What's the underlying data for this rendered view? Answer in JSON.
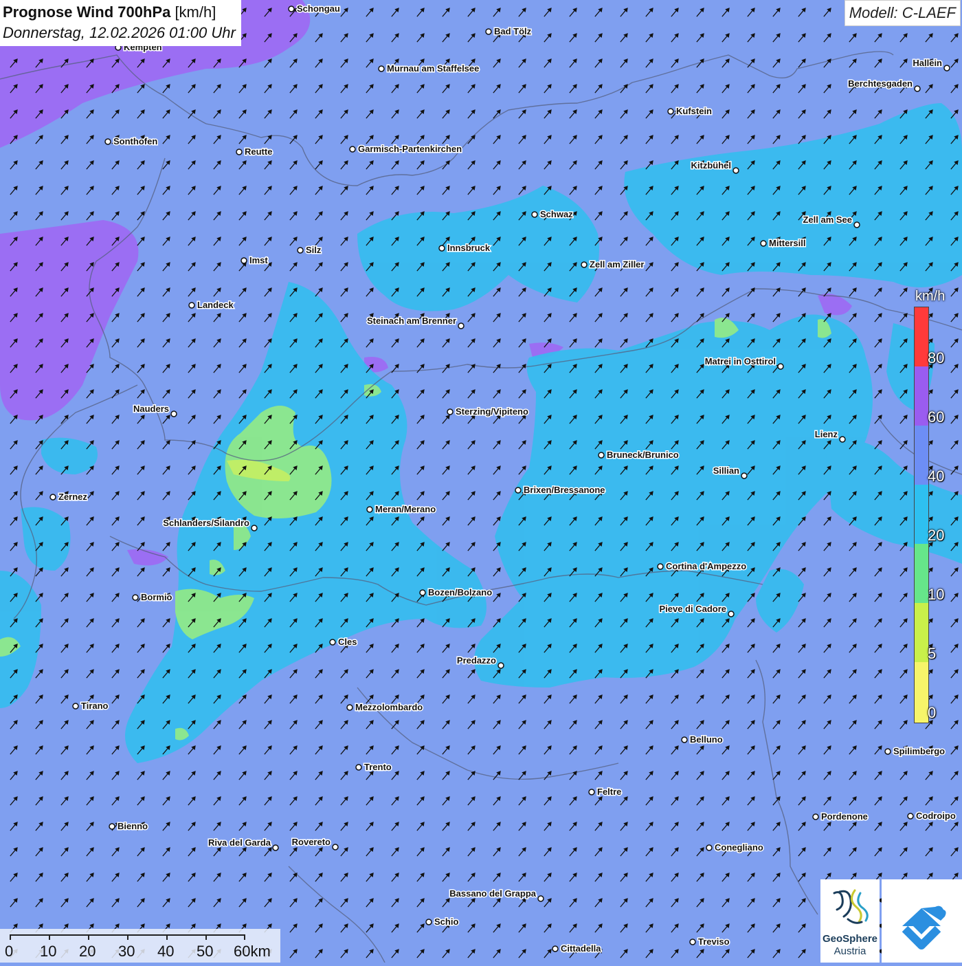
{
  "title": {
    "main": "Prognose Wind 700hPa",
    "unit": "[km/h]",
    "datetime": "Donnerstag, 12.02.2026 01:00 Uhr"
  },
  "model": "Modell: C-LAEF",
  "legend": {
    "unit": "km/h",
    "labels": [
      "80",
      "60",
      "40",
      "20",
      "10",
      "5",
      "0"
    ],
    "colors": [
      "#ff3a3a",
      "#9a5cf0",
      "#6d8ef5",
      "#2ec0f0",
      "#66e68a",
      "#c9f04a",
      "#f7f56a"
    ]
  },
  "scalebar": {
    "labels": [
      "0",
      "10",
      "20",
      "30",
      "40",
      "50",
      "60km"
    ]
  },
  "logos": {
    "geosphere_name": "GeoSphere",
    "geosphere_sub": "Austria"
  },
  "places": [
    {
      "name": "Schongau"
    },
    {
      "name": "Bad Tölz"
    },
    {
      "name": "Kempten"
    },
    {
      "name": "Murnau am Staffelsee"
    },
    {
      "name": "Hallein"
    },
    {
      "name": "Berchtesgaden"
    },
    {
      "name": "Kufstein"
    },
    {
      "name": "Sonthofen"
    },
    {
      "name": "Reutte"
    },
    {
      "name": "Garmisch-Partenkirchen"
    },
    {
      "name": "Kitzbühel"
    },
    {
      "name": "Schwaz"
    },
    {
      "name": "Zell am See"
    },
    {
      "name": "Mittersill"
    },
    {
      "name": "Innsbruck"
    },
    {
      "name": "Silz"
    },
    {
      "name": "Imst"
    },
    {
      "name": "Zell am Ziller"
    },
    {
      "name": "Landeck"
    },
    {
      "name": "Steinach am Brenner"
    },
    {
      "name": "Matrei in Osttirol"
    },
    {
      "name": "Nauders"
    },
    {
      "name": "Sterzing/Vipiteno"
    },
    {
      "name": "Lienz"
    },
    {
      "name": "Bruneck/Brunico"
    },
    {
      "name": "Sillian"
    },
    {
      "name": "Zernez"
    },
    {
      "name": "Brixen/Bressanone"
    },
    {
      "name": "Meran/Merano"
    },
    {
      "name": "Schlanders/Silandro"
    },
    {
      "name": "Cortina d'Ampezzo"
    },
    {
      "name": "Bormio"
    },
    {
      "name": "Bozen/Bolzano"
    },
    {
      "name": "Pieve di Cadore"
    },
    {
      "name": "Cles"
    },
    {
      "name": "Predazzo"
    },
    {
      "name": "Tirano"
    },
    {
      "name": "Mezzolombardo"
    },
    {
      "name": "Belluno"
    },
    {
      "name": "Spilimbergo"
    },
    {
      "name": "Trento"
    },
    {
      "name": "Feltre"
    },
    {
      "name": "Pordenone"
    },
    {
      "name": "Codroipo"
    },
    {
      "name": "Bienno"
    },
    {
      "name": "Riva del Garda"
    },
    {
      "name": "Rovereto"
    },
    {
      "name": "Conegliano"
    },
    {
      "name": "Bassano del Grappa"
    },
    {
      "name": "Schio"
    },
    {
      "name": "Treviso"
    },
    {
      "name": "Cittadella"
    }
  ]
}
